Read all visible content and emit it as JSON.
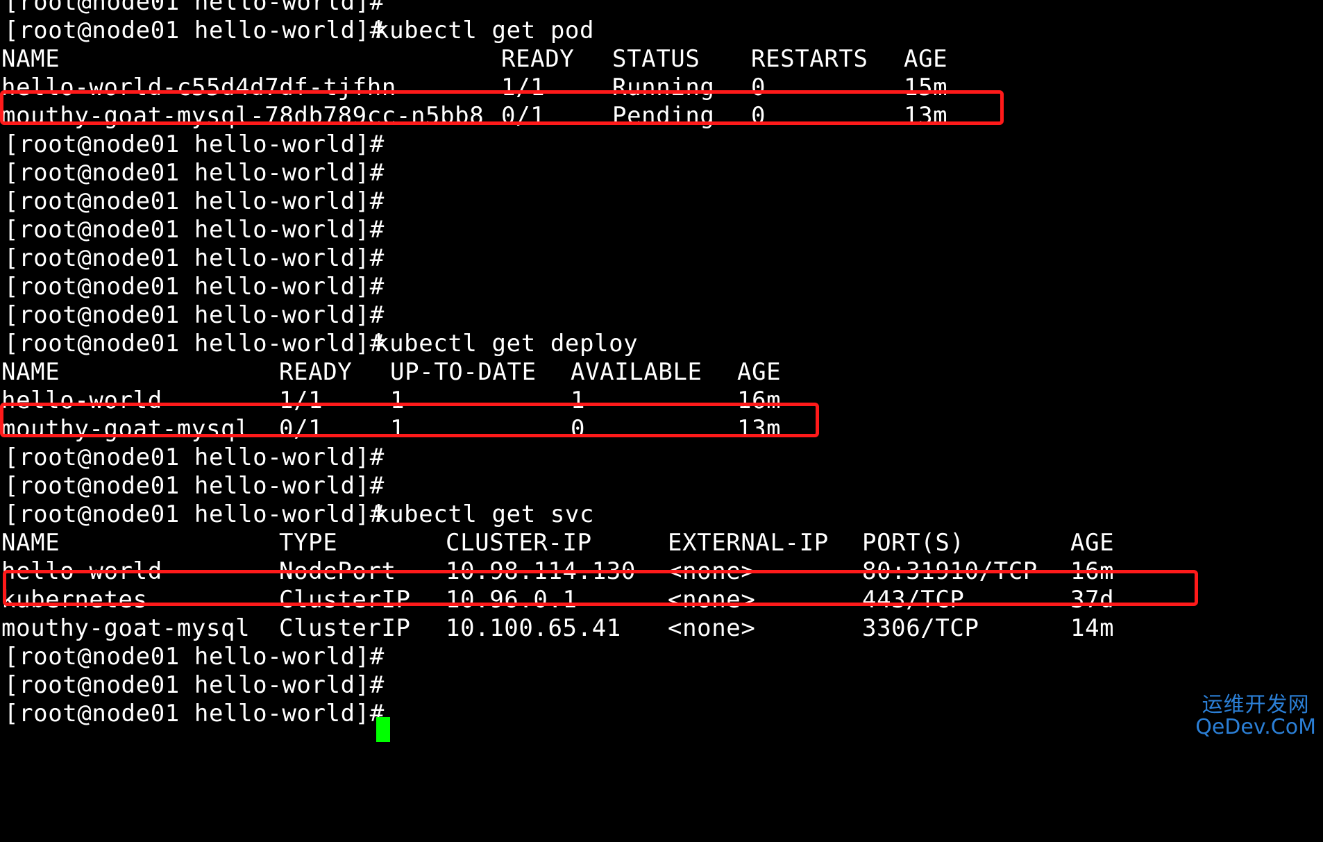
{
  "terminal": {
    "prompt": "[root@node01 hello-world]#",
    "cursor_color": "#00ff00",
    "highlight_color": "#ff1a1a"
  },
  "commands": {
    "get_pod": "kubectl get pod",
    "get_deploy": "kubectl get deploy",
    "get_svc": "kubectl get svc"
  },
  "pods": {
    "headers": [
      "NAME",
      "READY",
      "STATUS",
      "RESTARTS",
      "AGE"
    ],
    "rows": [
      [
        "hello-world-c55d4d7df-tjfhn",
        "1/1",
        "Running",
        "0",
        "15m"
      ],
      [
        "mouthy-goat-mysql-78db789cc-n5bb8",
        "0/1",
        "Pending",
        "0",
        "13m"
      ]
    ]
  },
  "deployments": {
    "headers": [
      "NAME",
      "READY",
      "UP-TO-DATE",
      "AVAILABLE",
      "AGE"
    ],
    "rows": [
      [
        "hello-world",
        "1/1",
        "1",
        "1",
        "16m"
      ],
      [
        "mouthy-goat-mysql",
        "0/1",
        "1",
        "0",
        "13m"
      ]
    ]
  },
  "services": {
    "headers": [
      "NAME",
      "TYPE",
      "CLUSTER-IP",
      "EXTERNAL-IP",
      "PORT(S)",
      "AGE"
    ],
    "rows": [
      [
        "hello-world",
        "NodePort",
        "10.98.114.130",
        "<none>",
        "80:31910/TCP",
        "16m"
      ],
      [
        "kubernetes",
        "ClusterIP",
        "10.96.0.1",
        "<none>",
        "443/TCP",
        "37d"
      ],
      [
        "mouthy-goat-mysql",
        "ClusterIP",
        "10.100.65.41",
        "<none>",
        "3306/TCP",
        "14m"
      ]
    ]
  },
  "watermark": {
    "line1": "运维开发网",
    "line2": "QeDev.CoM"
  }
}
